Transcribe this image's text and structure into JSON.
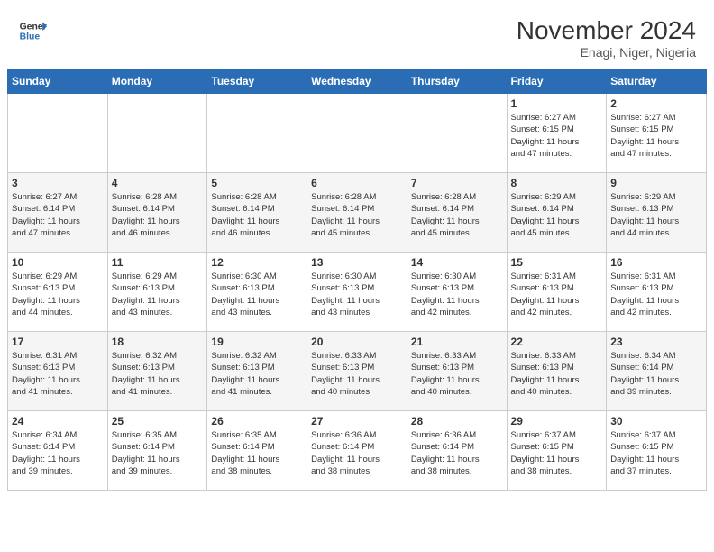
{
  "header": {
    "logo_line1": "General",
    "logo_line2": "Blue",
    "title": "November 2024",
    "subtitle": "Enagi, Niger, Nigeria"
  },
  "weekdays": [
    "Sunday",
    "Monday",
    "Tuesday",
    "Wednesday",
    "Thursday",
    "Friday",
    "Saturday"
  ],
  "weeks": [
    [
      {
        "day": "",
        "info": ""
      },
      {
        "day": "",
        "info": ""
      },
      {
        "day": "",
        "info": ""
      },
      {
        "day": "",
        "info": ""
      },
      {
        "day": "",
        "info": ""
      },
      {
        "day": "1",
        "info": "Sunrise: 6:27 AM\nSunset: 6:15 PM\nDaylight: 11 hours\nand 47 minutes."
      },
      {
        "day": "2",
        "info": "Sunrise: 6:27 AM\nSunset: 6:15 PM\nDaylight: 11 hours\nand 47 minutes."
      }
    ],
    [
      {
        "day": "3",
        "info": "Sunrise: 6:27 AM\nSunset: 6:14 PM\nDaylight: 11 hours\nand 47 minutes."
      },
      {
        "day": "4",
        "info": "Sunrise: 6:28 AM\nSunset: 6:14 PM\nDaylight: 11 hours\nand 46 minutes."
      },
      {
        "day": "5",
        "info": "Sunrise: 6:28 AM\nSunset: 6:14 PM\nDaylight: 11 hours\nand 46 minutes."
      },
      {
        "day": "6",
        "info": "Sunrise: 6:28 AM\nSunset: 6:14 PM\nDaylight: 11 hours\nand 45 minutes."
      },
      {
        "day": "7",
        "info": "Sunrise: 6:28 AM\nSunset: 6:14 PM\nDaylight: 11 hours\nand 45 minutes."
      },
      {
        "day": "8",
        "info": "Sunrise: 6:29 AM\nSunset: 6:14 PM\nDaylight: 11 hours\nand 45 minutes."
      },
      {
        "day": "9",
        "info": "Sunrise: 6:29 AM\nSunset: 6:13 PM\nDaylight: 11 hours\nand 44 minutes."
      }
    ],
    [
      {
        "day": "10",
        "info": "Sunrise: 6:29 AM\nSunset: 6:13 PM\nDaylight: 11 hours\nand 44 minutes."
      },
      {
        "day": "11",
        "info": "Sunrise: 6:29 AM\nSunset: 6:13 PM\nDaylight: 11 hours\nand 43 minutes."
      },
      {
        "day": "12",
        "info": "Sunrise: 6:30 AM\nSunset: 6:13 PM\nDaylight: 11 hours\nand 43 minutes."
      },
      {
        "day": "13",
        "info": "Sunrise: 6:30 AM\nSunset: 6:13 PM\nDaylight: 11 hours\nand 43 minutes."
      },
      {
        "day": "14",
        "info": "Sunrise: 6:30 AM\nSunset: 6:13 PM\nDaylight: 11 hours\nand 42 minutes."
      },
      {
        "day": "15",
        "info": "Sunrise: 6:31 AM\nSunset: 6:13 PM\nDaylight: 11 hours\nand 42 minutes."
      },
      {
        "day": "16",
        "info": "Sunrise: 6:31 AM\nSunset: 6:13 PM\nDaylight: 11 hours\nand 42 minutes."
      }
    ],
    [
      {
        "day": "17",
        "info": "Sunrise: 6:31 AM\nSunset: 6:13 PM\nDaylight: 11 hours\nand 41 minutes."
      },
      {
        "day": "18",
        "info": "Sunrise: 6:32 AM\nSunset: 6:13 PM\nDaylight: 11 hours\nand 41 minutes."
      },
      {
        "day": "19",
        "info": "Sunrise: 6:32 AM\nSunset: 6:13 PM\nDaylight: 11 hours\nand 41 minutes."
      },
      {
        "day": "20",
        "info": "Sunrise: 6:33 AM\nSunset: 6:13 PM\nDaylight: 11 hours\nand 40 minutes."
      },
      {
        "day": "21",
        "info": "Sunrise: 6:33 AM\nSunset: 6:13 PM\nDaylight: 11 hours\nand 40 minutes."
      },
      {
        "day": "22",
        "info": "Sunrise: 6:33 AM\nSunset: 6:13 PM\nDaylight: 11 hours\nand 40 minutes."
      },
      {
        "day": "23",
        "info": "Sunrise: 6:34 AM\nSunset: 6:14 PM\nDaylight: 11 hours\nand 39 minutes."
      }
    ],
    [
      {
        "day": "24",
        "info": "Sunrise: 6:34 AM\nSunset: 6:14 PM\nDaylight: 11 hours\nand 39 minutes."
      },
      {
        "day": "25",
        "info": "Sunrise: 6:35 AM\nSunset: 6:14 PM\nDaylight: 11 hours\nand 39 minutes."
      },
      {
        "day": "26",
        "info": "Sunrise: 6:35 AM\nSunset: 6:14 PM\nDaylight: 11 hours\nand 38 minutes."
      },
      {
        "day": "27",
        "info": "Sunrise: 6:36 AM\nSunset: 6:14 PM\nDaylight: 11 hours\nand 38 minutes."
      },
      {
        "day": "28",
        "info": "Sunrise: 6:36 AM\nSunset: 6:14 PM\nDaylight: 11 hours\nand 38 minutes."
      },
      {
        "day": "29",
        "info": "Sunrise: 6:37 AM\nSunset: 6:15 PM\nDaylight: 11 hours\nand 38 minutes."
      },
      {
        "day": "30",
        "info": "Sunrise: 6:37 AM\nSunset: 6:15 PM\nDaylight: 11 hours\nand 37 minutes."
      }
    ]
  ]
}
